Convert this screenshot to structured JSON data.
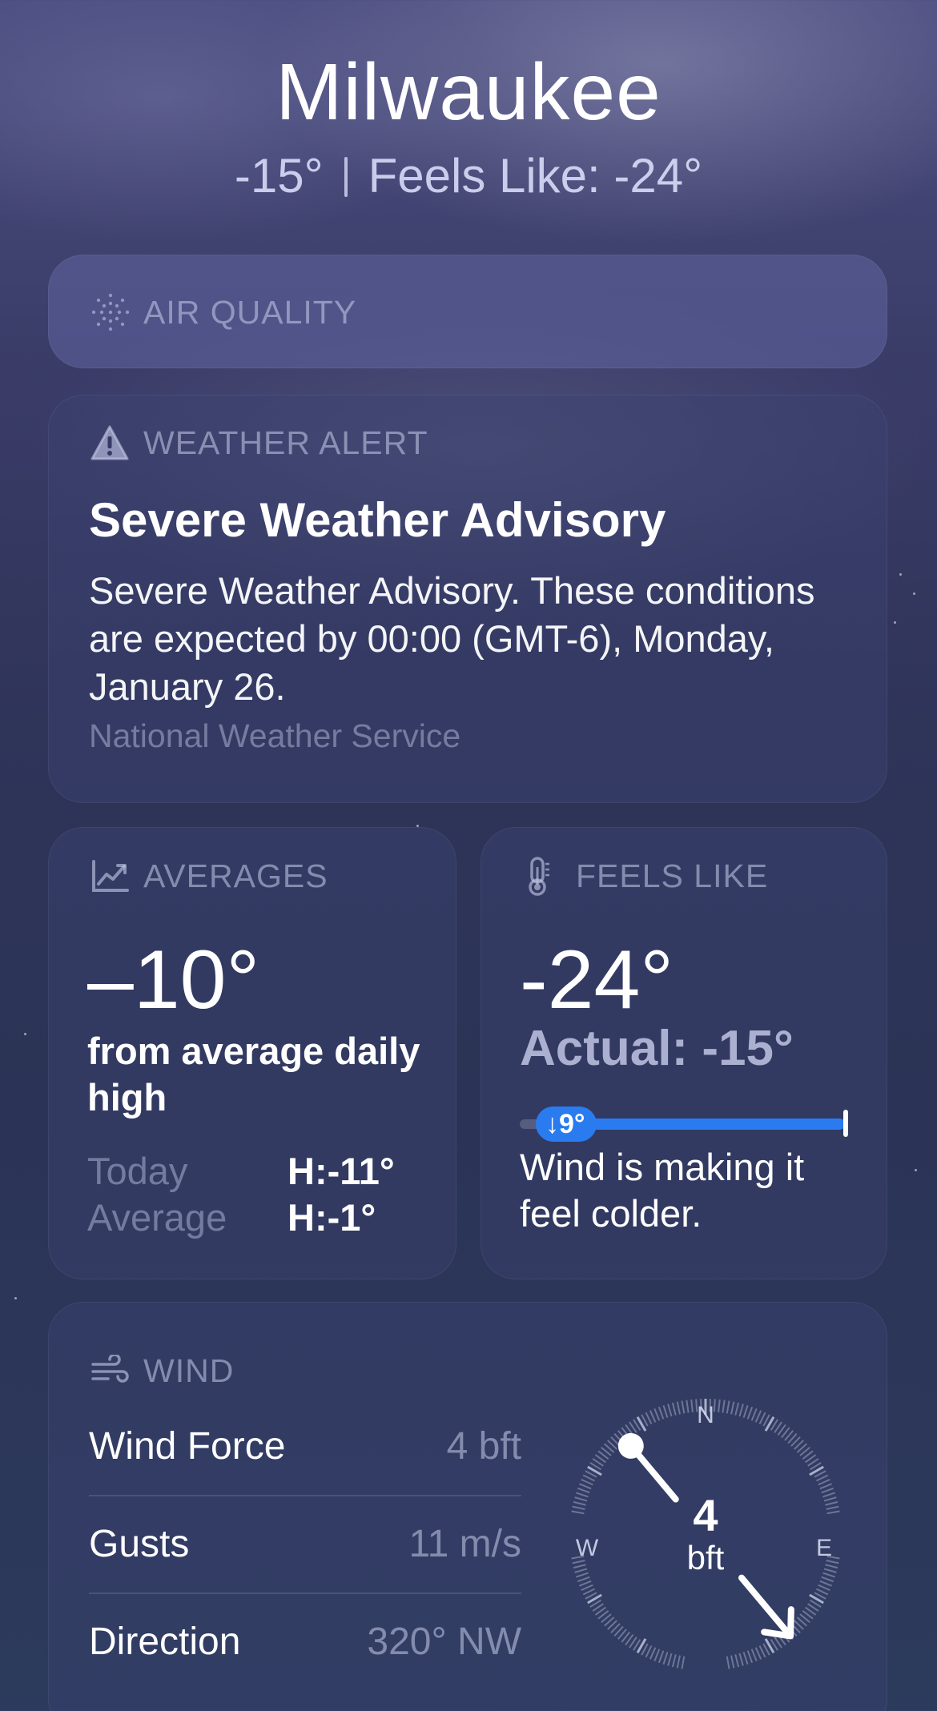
{
  "location": {
    "city": "Milwaukee",
    "temperature": "-15°",
    "feels_like_text": "Feels Like: -24°"
  },
  "air_quality": {
    "header": "AIR QUALITY",
    "icon": "dotted-circle-icon"
  },
  "weather_alert": {
    "header": "WEATHER ALERT",
    "icon": "warning-triangle-icon",
    "title": "Severe Weather Advisory",
    "body": "Severe Weather Advisory. These conditions are expected by 00:00 (GMT-6), Monday, January 26.",
    "source": "National Weather Service"
  },
  "averages": {
    "header": "AVERAGES",
    "icon": "chart-line-icon",
    "value": "–10°",
    "caption": "from average daily high",
    "rows": [
      {
        "label": "Today",
        "value": "H:-11°"
      },
      {
        "label": "Average",
        "value": "H:-1°"
      }
    ]
  },
  "feels_like": {
    "header": "FEELS LIKE",
    "icon": "thermometer-icon",
    "value": "-24°",
    "actual": "Actual: -15°",
    "difference": "↓9°",
    "description": "Wind is making it feel colder.",
    "accent_color": "#2a7bf0"
  },
  "wind": {
    "header": "WIND",
    "icon": "wind-icon",
    "rows": [
      {
        "label": "Wind Force",
        "value": "4 bft"
      },
      {
        "label": "Gusts",
        "value": "11 m/s"
      },
      {
        "label": "Direction",
        "value": "320° NW"
      }
    ],
    "compass": {
      "value": "4",
      "unit": "bft",
      "n": "N",
      "e": "E",
      "w": "W",
      "direction_degrees": 320
    }
  }
}
